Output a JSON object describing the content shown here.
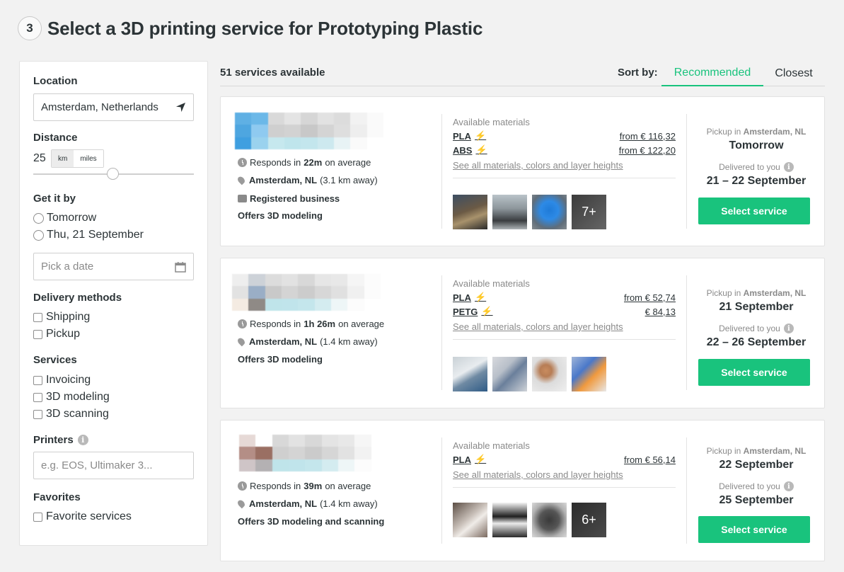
{
  "header": {
    "step": "3",
    "title": "Select a 3D printing service for Prototyping Plastic"
  },
  "filters": {
    "location": {
      "label": "Location",
      "value": "Amsterdam, Netherlands"
    },
    "distance": {
      "label": "Distance",
      "value": "25",
      "units": [
        "km",
        "miles"
      ],
      "selected_unit": "km"
    },
    "get_it_by": {
      "label": "Get it by",
      "options": [
        "Tomorrow",
        "Thu, 21 September"
      ],
      "date_placeholder": "Pick a date"
    },
    "delivery_methods": {
      "label": "Delivery methods",
      "options": [
        "Shipping",
        "Pickup"
      ]
    },
    "services": {
      "label": "Services",
      "options": [
        "Invoicing",
        "3D modeling",
        "3D scanning"
      ]
    },
    "printers": {
      "label": "Printers",
      "placeholder": "e.g. EOS, Ultimaker 3..."
    },
    "favorites": {
      "label": "Favorites",
      "option": "Favorite services"
    }
  },
  "results": {
    "count_text": "51 services available",
    "sort_label": "Sort by:",
    "sort_options": [
      "Recommended",
      "Closest"
    ],
    "sort_selected": "Recommended"
  },
  "accent_color": "#19c37d",
  "services": [
    {
      "responds_prefix": "Responds in",
      "responds_time": "22m",
      "responds_suffix": "on average",
      "location": "Amsterdam, NL",
      "distance": "(3.1 km away)",
      "registered_business": "Registered business",
      "offers": "Offers 3D modeling",
      "materials_title": "Available materials",
      "materials": [
        {
          "name": "PLA",
          "price": "from € 116,32"
        },
        {
          "name": "ABS",
          "price": "from € 122,20"
        }
      ],
      "see_all": "See all materials, colors and layer heights",
      "more_photos": "7+",
      "pickup_prefix": "Pickup in",
      "pickup_city": "Amsterdam, NL",
      "pickup_date": "Tomorrow",
      "delivered_label": "Delivered to you",
      "delivered_date": "21 – 22 September",
      "button": "Select service"
    },
    {
      "responds_prefix": "Responds in",
      "responds_time": "1h 26m",
      "responds_suffix": "on average",
      "location": "Amsterdam, NL",
      "distance": "(1.4 km away)",
      "offers": "Offers 3D modeling",
      "materials_title": "Available materials",
      "materials": [
        {
          "name": "PLA",
          "price": "from € 52,74"
        },
        {
          "name": "PETG",
          "price": "€ 84,13"
        }
      ],
      "see_all": "See all materials, colors and layer heights",
      "pickup_prefix": "Pickup in",
      "pickup_city": "Amsterdam, NL",
      "pickup_date": "21 September",
      "delivered_label": "Delivered to you",
      "delivered_date": "22 – 26 September",
      "button": "Select service"
    },
    {
      "responds_prefix": "Responds in",
      "responds_time": "39m",
      "responds_suffix": "on average",
      "location": "Amsterdam, NL",
      "distance": "(1.4 km away)",
      "offers": "Offers 3D modeling and scanning",
      "materials_title": "Available materials",
      "materials": [
        {
          "name": "PLA",
          "price": "from € 56,14"
        }
      ],
      "see_all": "See all materials, colors and layer heights",
      "more_photos": "6+",
      "pickup_prefix": "Pickup in",
      "pickup_city": "Amsterdam, NL",
      "pickup_date": "22 September",
      "delivered_label": "Delivered to you",
      "delivered_date": "25 September",
      "button": "Select service"
    }
  ]
}
